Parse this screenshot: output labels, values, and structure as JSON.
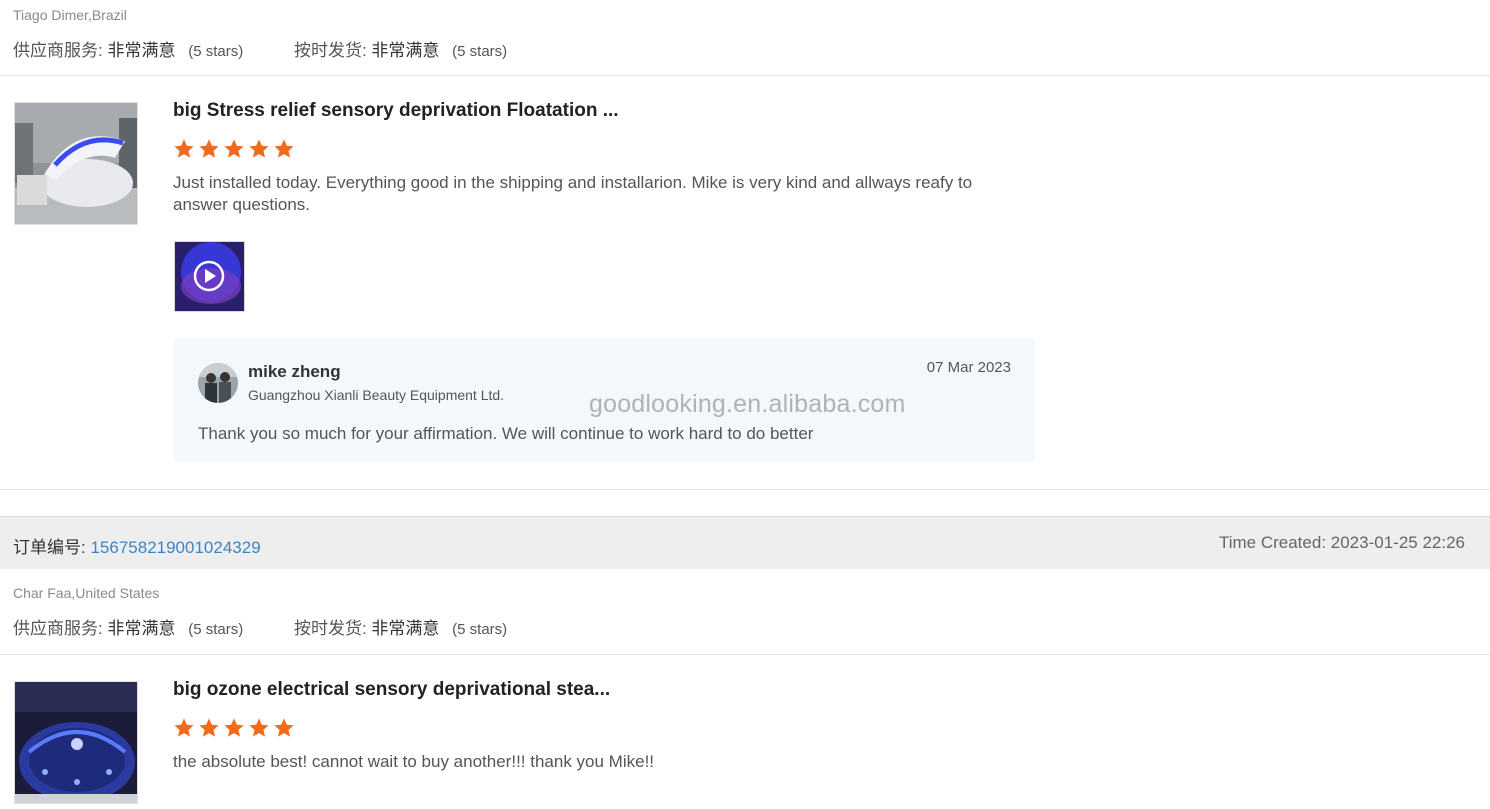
{
  "review1": {
    "buyer": "Tiago Dimer,Brazil",
    "supplier_service_label": "供应商服务:",
    "supplier_service_value": "非常满意",
    "supplier_service_stars": "(5 stars)",
    "on_time_label": "按时发货:",
    "on_time_value": "非常满意",
    "on_time_stars": "(5 stars)",
    "product_title": "big Stress relief sensory deprivation Floatation ...",
    "rating": 5,
    "text": "Just installed today. Everything good in the shipping and installarion. Mike is very kind and allways reafy to answer questions.",
    "reply": {
      "name": "mike zheng",
      "company": "Guangzhou Xianli Beauty Equipment Ltd.",
      "date": "07 Mar 2023",
      "text": "Thank you so much for your affirmation. We will continue to work hard to do better"
    }
  },
  "watermark": "goodlooking.en.alibaba.com",
  "order": {
    "label": "订单编号:",
    "number": "156758219001024329",
    "time_created": "Time Created: 2023-01-25 22:26"
  },
  "review2": {
    "buyer": "Char Faa,United States",
    "supplier_service_label": "供应商服务:",
    "supplier_service_value": "非常满意",
    "supplier_service_stars": "(5 stars)",
    "on_time_label": "按时发货:",
    "on_time_value": "非常满意",
    "on_time_stars": "(5 stars)",
    "product_title": "big ozone electrical sensory deprivational stea...",
    "rating": 5,
    "text": "the absolute best! cannot wait to buy another!!! thank you Mike!!"
  },
  "colors": {
    "star": "#f26b1d",
    "order_link": "#3a86c8",
    "reply_bg": "#f5f8fb",
    "order_bar_bg": "#eeeeee"
  }
}
